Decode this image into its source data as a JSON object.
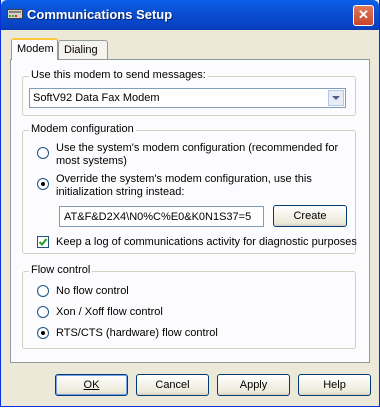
{
  "window": {
    "title": "Communications Setup",
    "close_glyph": "✕"
  },
  "tabs": [
    {
      "label": "Modem"
    },
    {
      "label": "Dialing"
    }
  ],
  "modem_select": {
    "legend": "Use this modem to send messages:",
    "value": "SoftV92 Data Fax Modem"
  },
  "modem_config": {
    "legend": "Modem configuration",
    "option_system_line1": "Use the system's modem configuration (recommended for",
    "option_system_line2": "most systems)",
    "option_override_line1": "Override the system's modem configuration, use this",
    "option_override_line2": "initialization string instead:",
    "init_string": "AT&F&D2X4\\N0%C%E0&K0N1S37=5",
    "create_label": "Create",
    "log_label": "Keep a log of communications activity for diagnostic purposes",
    "selected": "override",
    "log_checked": true
  },
  "flow_control": {
    "legend": "Flow control",
    "options": [
      {
        "label": "No flow control"
      },
      {
        "label": "Xon / Xoff flow control"
      },
      {
        "label": "RTS/CTS (hardware) flow control"
      }
    ],
    "selected_index": 2
  },
  "buttons": {
    "ok": "OK",
    "cancel": "Cancel",
    "apply": "Apply",
    "help": "Help"
  },
  "colors": {
    "titlebar": "#0a4fd4",
    "dialog_bg": "#ece9d8",
    "panel_bg": "#fcfcfe"
  }
}
